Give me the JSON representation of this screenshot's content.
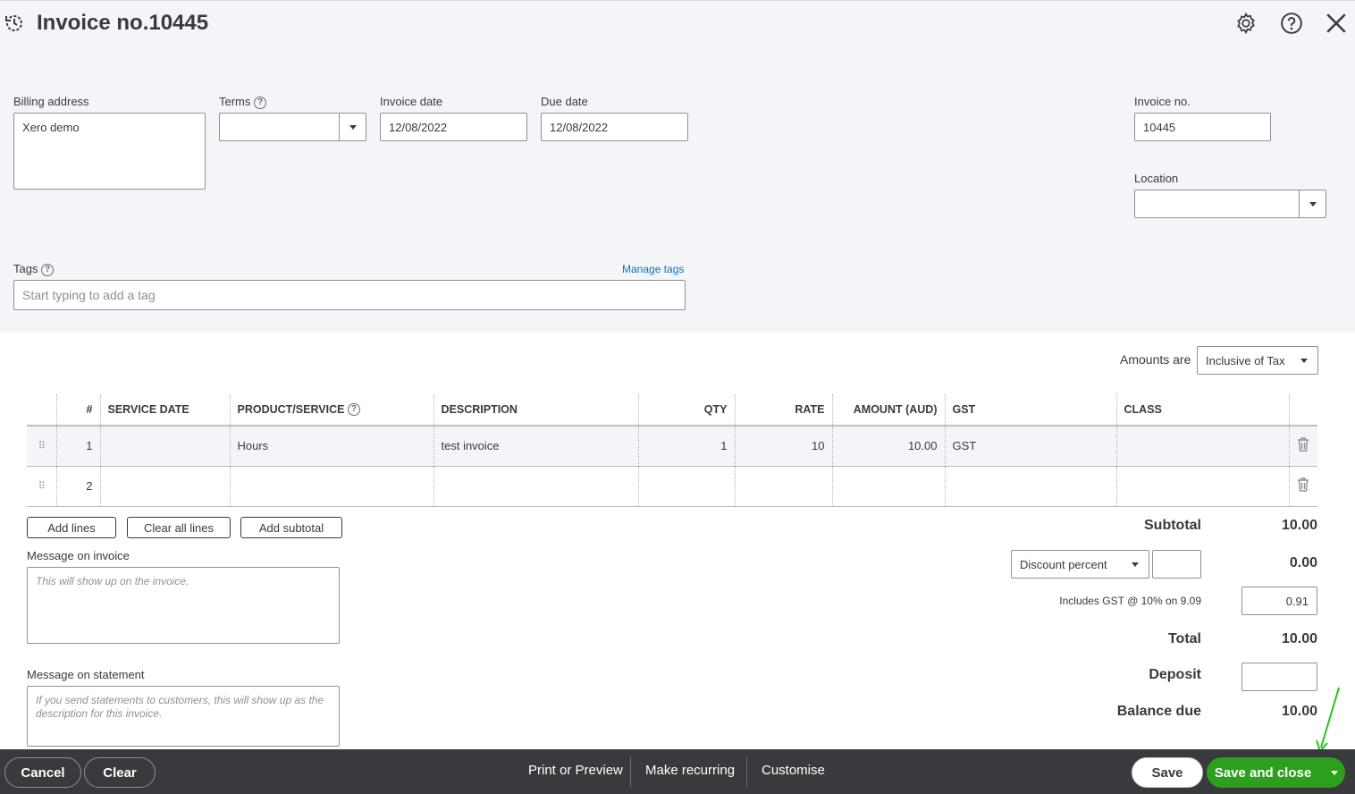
{
  "header": {
    "title": "Invoice no.10445",
    "icons": [
      "history-icon",
      "gear-icon",
      "help-icon",
      "close-icon"
    ]
  },
  "form": {
    "billing_label": "Billing address",
    "billing_value": "Xero demo",
    "terms_label": "Terms",
    "terms_value": "",
    "invoice_date_label": "Invoice date",
    "invoice_date_value": "12/08/2022",
    "due_date_label": "Due date",
    "due_date_value": "12/08/2022",
    "invoice_no_label": "Invoice no.",
    "invoice_no_value": "10445",
    "location_label": "Location",
    "location_value": "",
    "tags_label": "Tags",
    "tags_placeholder": "Start typing to add a tag",
    "manage_tags": "Manage tags"
  },
  "amounts": {
    "label": "Amounts are",
    "value": "Inclusive of Tax"
  },
  "table": {
    "headers": [
      "#",
      "SERVICE DATE",
      "PRODUCT/SERVICE",
      "DESCRIPTION",
      "QTY",
      "RATE",
      "AMOUNT (AUD)",
      "GST",
      "CLASS"
    ],
    "rows": [
      {
        "num": "1",
        "service_date": "",
        "product": "Hours",
        "description": "test invoice",
        "qty": "1",
        "rate": "10",
        "amount": "10.00",
        "gst": "GST",
        "class": ""
      },
      {
        "num": "2",
        "service_date": "",
        "product": "",
        "description": "",
        "qty": "",
        "rate": "",
        "amount": "",
        "gst": "",
        "class": ""
      }
    ]
  },
  "buttons": {
    "add_lines": "Add lines",
    "clear_all": "Clear all lines",
    "add_subtotal": "Add subtotal"
  },
  "messages": {
    "invoice_label": "Message on invoice",
    "invoice_placeholder": "This will show up on the invoice.",
    "statement_label": "Message on statement",
    "statement_placeholder": "If you send statements to customers, this will show up as the description for this invoice."
  },
  "summary": {
    "subtotal_label": "Subtotal",
    "subtotal_value": "10.00",
    "discount_select": "Discount percent",
    "discount_input": "",
    "discount_value": "0.00",
    "gst_label": "Includes GST @ 10% on 9.09",
    "gst_value": "0.91",
    "total_label": "Total",
    "total_value": "10.00",
    "deposit_label": "Deposit",
    "deposit_value": "",
    "balance_label": "Balance due",
    "balance_value": "10.00"
  },
  "footer": {
    "cancel": "Cancel",
    "clear": "Clear",
    "print": "Print or Preview",
    "recurring": "Make recurring",
    "customise": "Customise",
    "save": "Save",
    "save_close": "Save and close"
  },
  "colors": {
    "green": "#2ca01c",
    "link": "#0077c5",
    "bar": "#393a3d"
  }
}
